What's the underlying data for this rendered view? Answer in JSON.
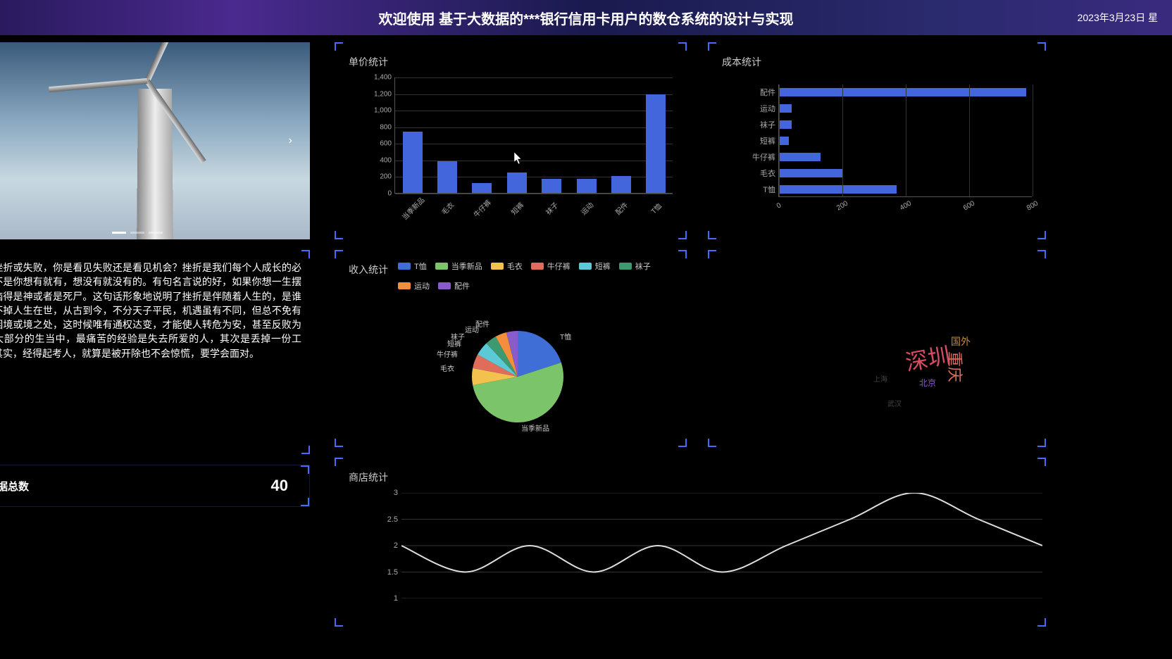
{
  "header": {
    "title": "欢迎使用 基于大数据的***银行信用卡用户的数仓系统的设计与实现",
    "date": "2023年3月23日 星"
  },
  "text_panel": {
    "body": "遇到挫折或失败，你是看见失败还是看见机会？挫折是我们每个人成长的必经历不是你想有就有，想没有就没有的。有句名言说的好，如果你想一生摆脱苦恼得是神或者是死尸。这句话形象地说明了挫折是伴随着人生的，是谁都逃不掉人生在世，从古到今，不分天子平民，机遇虽有不同，但总不免有身陷困境或境之处，这时候唯有通权达变，才能使人转危为安，甚至反败为胜。大部分的生当中，最痛苦的经验是失去所爱的人，其次是丢掉一份工作。其实，经得起考人，就算是被开除也不会惊慌，要学会面对。"
  },
  "data_total": {
    "label": "数据总数",
    "value": "40"
  },
  "chart_data": [
    {
      "id": "bar_price",
      "type": "bar",
      "title": "单价统计",
      "categories": [
        "当季新品",
        "毛衣",
        "牛仔裤",
        "短裤",
        "袜子",
        "运动",
        "配件",
        "T恤"
      ],
      "values": [
        740,
        380,
        120,
        250,
        170,
        170,
        200,
        1190
      ],
      "ylim": [
        0,
        1400
      ],
      "yticks": [
        0,
        200,
        400,
        600,
        800,
        1000,
        1200,
        1400
      ]
    },
    {
      "id": "hbar_cost",
      "type": "bar",
      "orientation": "horizontal",
      "title": "成本统计",
      "categories": [
        "配件",
        "运动",
        "袜子",
        "短裤",
        "牛仔裤",
        "毛衣",
        "T恤"
      ],
      "values": [
        780,
        40,
        40,
        30,
        130,
        200,
        370
      ],
      "xlim": [
        0,
        800
      ],
      "xticks": [
        0,
        200,
        400,
        600,
        800
      ]
    },
    {
      "id": "pie_income",
      "type": "pie",
      "title": "收入统计",
      "series": [
        {
          "name": "T恤",
          "value": 20,
          "color": "#3f6fd6"
        },
        {
          "name": "当季新品",
          "value": 52,
          "color": "#7cc46a"
        },
        {
          "name": "毛衣",
          "value": 6,
          "color": "#f2c14e"
        },
        {
          "name": "牛仔裤",
          "value": 5,
          "color": "#e06c5c"
        },
        {
          "name": "短裤",
          "value": 5,
          "color": "#5cc9d6"
        },
        {
          "name": "袜子",
          "value": 4,
          "color": "#3d9970"
        },
        {
          "name": "运动",
          "value": 4,
          "color": "#f28e3c"
        },
        {
          "name": "配件",
          "value": 4,
          "color": "#8a5cc9"
        }
      ]
    },
    {
      "id": "wordcloud",
      "type": "other",
      "title": "",
      "words": [
        {
          "text": "深圳",
          "size": 32,
          "color": "#d94a64"
        },
        {
          "text": "重庆",
          "size": 22,
          "color": "#e06c5c"
        },
        {
          "text": "国外",
          "size": 14,
          "color": "#c28a3c"
        },
        {
          "text": "北京",
          "size": 12,
          "color": "#8a5cc9"
        },
        {
          "text": "上海",
          "size": 10,
          "color": "#444"
        },
        {
          "text": "武汉",
          "size": 10,
          "color": "#444"
        }
      ]
    },
    {
      "id": "line_store",
      "type": "line",
      "title": "商店统计",
      "x_range": [
        0,
        10
      ],
      "ylim": [
        1,
        3
      ],
      "yticks": [
        1,
        1.5,
        2,
        2.5,
        3
      ],
      "values": [
        2,
        1.5,
        2,
        1.5,
        2,
        1.5,
        2,
        2.5,
        3,
        2.5,
        2
      ]
    }
  ]
}
